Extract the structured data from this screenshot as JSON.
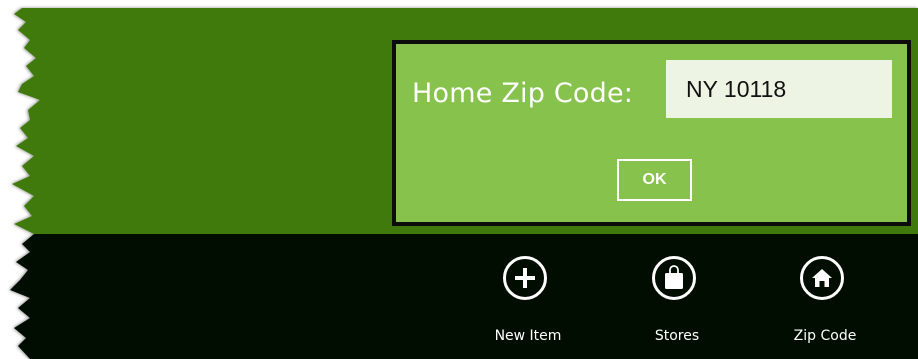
{
  "colors": {
    "header_bg": "#3f7a07",
    "appbar_bg": "#050f00",
    "flyout_bg": "#86c24c",
    "flyout_border": "#0c0c0c",
    "input_bg": "#eef4e4",
    "text_light": "#ffffff"
  },
  "flyout": {
    "label": "Home Zip Code:",
    "input_value": "NY 10118",
    "ok_label": "OK"
  },
  "appbar": {
    "buttons": [
      {
        "label": "New Item",
        "icon": "plus-icon"
      },
      {
        "label": "Stores",
        "icon": "shopping-bag-icon"
      },
      {
        "label": "Zip Code",
        "icon": "home-icon"
      }
    ]
  }
}
